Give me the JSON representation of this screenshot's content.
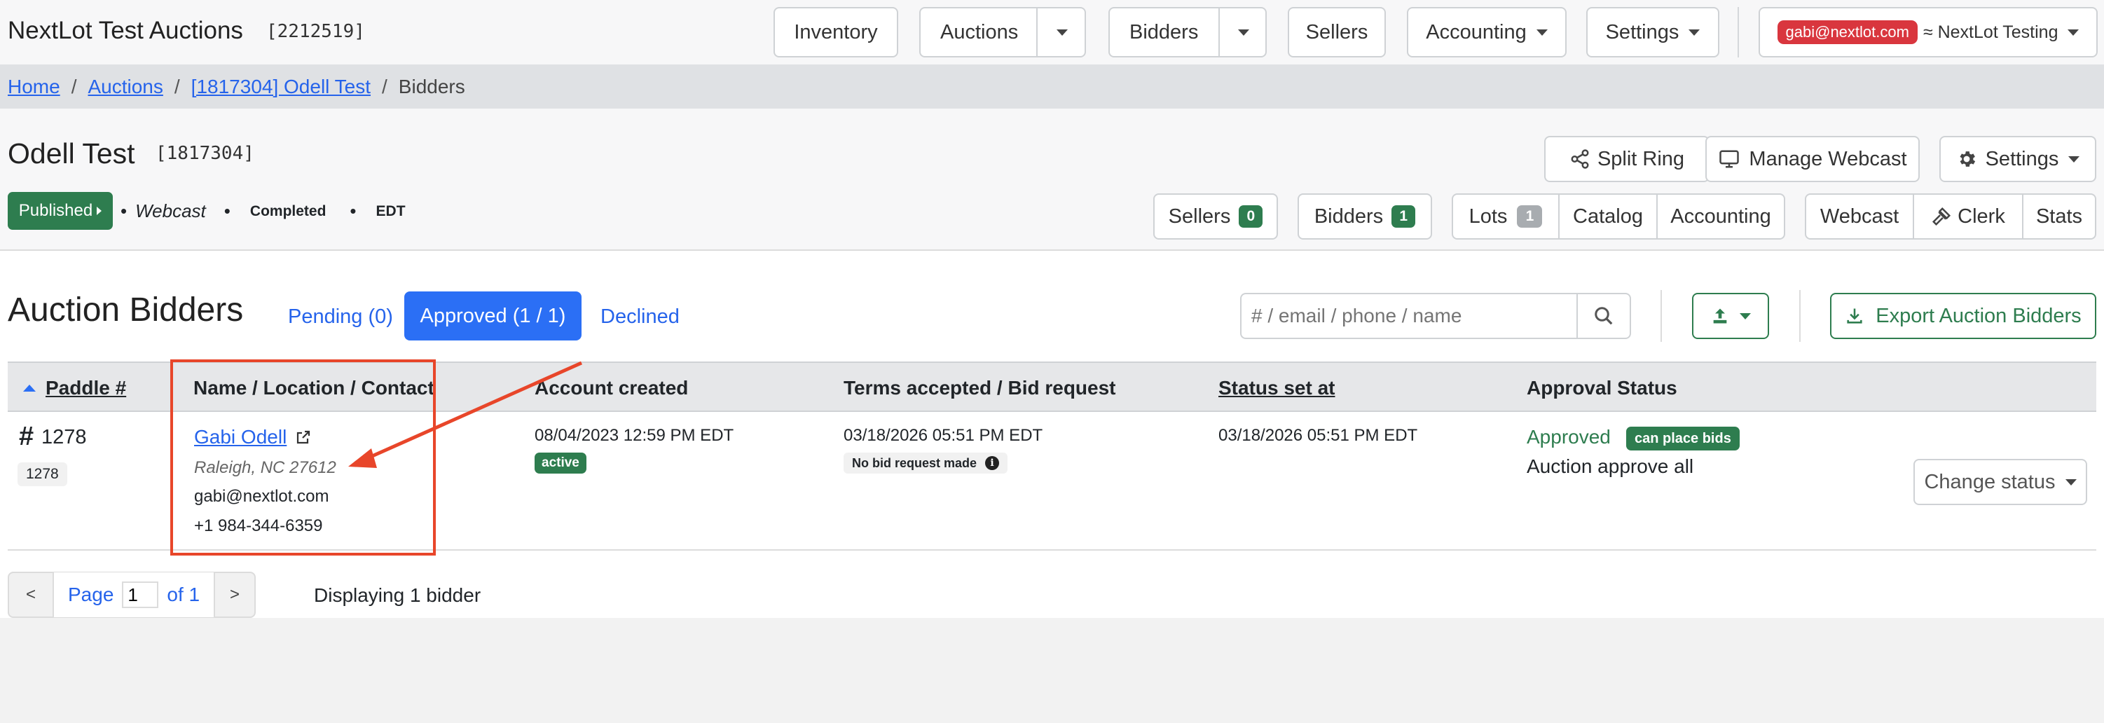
{
  "app": {
    "title": "NextLot Test Auctions",
    "id": "[2212519]"
  },
  "nav": {
    "inventory": "Inventory",
    "auctions": "Auctions",
    "bidders": "Bidders",
    "sellers": "Sellers",
    "accounting": "Accounting",
    "settings": "Settings",
    "user_email": "gabi@nextlot.com",
    "org": "≈ NextLot Testing"
  },
  "breadcrumb": {
    "home": "Home",
    "auctions": "Auctions",
    "auction": "[1817304] Odell Test",
    "current": "Bidders",
    "sep": "/"
  },
  "auction": {
    "name": "Odell Test",
    "id": "[1817304]",
    "status": "Published",
    "meta": [
      "Webcast",
      "Completed",
      "EDT"
    ],
    "bullet": "•"
  },
  "actions": {
    "split_ring": "Split Ring",
    "manage_webcast": "Manage Webcast",
    "settings": "Settings"
  },
  "subnav": {
    "sellers": "Sellers",
    "sellers_count": "0",
    "bidders": "Bidders",
    "bidders_count": "1",
    "lots": "Lots",
    "lots_count": "1",
    "catalog": "Catalog",
    "accounting": "Accounting",
    "webcast": "Webcast",
    "clerk": "Clerk",
    "stats": "Stats"
  },
  "section": {
    "title": "Auction Bidders",
    "tabs": {
      "pending": "Pending (0)",
      "approved": "Approved (1 / 1)",
      "declined": "Declined"
    },
    "search_placeholder": "# / email / phone / name",
    "export": "Export Auction Bidders"
  },
  "table": {
    "headers": {
      "paddle": "Paddle #",
      "name": "Name / Location / Contact",
      "account": "Account created",
      "terms": "Terms accepted / Bid request",
      "status_set": "Status set at",
      "approval": "Approval Status"
    },
    "rows": [
      {
        "hash": "#",
        "paddle": "1278",
        "paddle_tag": "1278",
        "name": "Gabi Odell",
        "location": "Raleigh, NC 27612",
        "email": "gabi@nextlot.com",
        "phone": "+1 984-344-6359",
        "account_created": "08/04/2023 12:59 PM EDT",
        "account_status": "active",
        "terms": "03/18/2026 05:51 PM EDT",
        "bid_request": "No bid request made",
        "status_set": "03/18/2026 05:51 PM EDT",
        "approval": "Approved",
        "approval_badge": "can place bids",
        "approval_note": "Auction approve all",
        "change_status": "Change status"
      }
    ]
  },
  "pagination": {
    "prev": "<",
    "page_label": "Page",
    "page": "1",
    "of": "of 1",
    "next": ">",
    "summary": "Displaying 1 bidder"
  },
  "colors": {
    "primary": "#2b6ff5",
    "success": "#2e7d4f",
    "danger": "#d9363e",
    "annotation": "#e8462a"
  }
}
